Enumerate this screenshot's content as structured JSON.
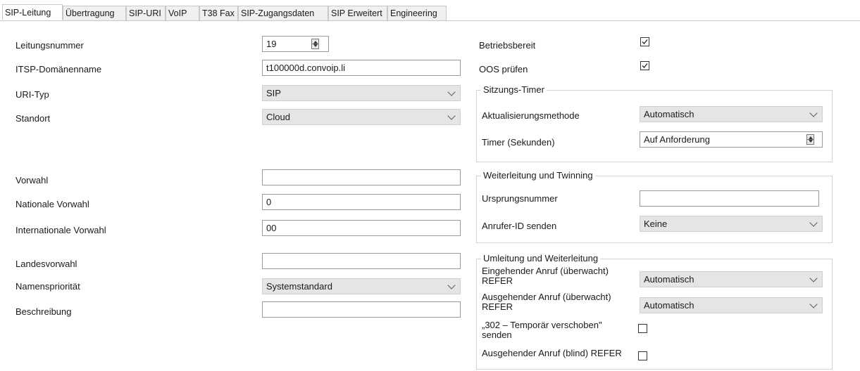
{
  "tabs": [
    "SIP-Leitung",
    "Übertragung",
    "SIP-URI",
    "VoIP",
    "T38 Fax",
    "SIP-Zugangsdaten",
    "SIP Erweitert",
    "Engineering"
  ],
  "left": {
    "leitungsnummer": {
      "label": "Leitungsnummer",
      "value": "19"
    },
    "itsp": {
      "label": "ITSP-Domänenname",
      "value": "t100000d.convoip.li"
    },
    "uri_typ": {
      "label": "URI-Typ",
      "value": "SIP"
    },
    "standort": {
      "label": "Standort",
      "value": "Cloud"
    },
    "vorwahl": {
      "label": "Vorwahl",
      "value": ""
    },
    "nationale_vorwahl": {
      "label": "Nationale Vorwahl",
      "value": "0"
    },
    "internationale_vorwahl": {
      "label": "Internationale Vorwahl",
      "value": "00"
    },
    "landesvorwahl": {
      "label": "Landesvorwahl",
      "value": ""
    },
    "namensprioritaet": {
      "label": "Namenspriorität",
      "value": "Systemstandard"
    },
    "beschreibung": {
      "label": "Beschreibung",
      "value": ""
    }
  },
  "right": {
    "betriebsbereit": {
      "label": "Betriebsbereit",
      "checked": true
    },
    "oos": {
      "label": "OOS prüfen",
      "checked": true
    },
    "sitzungs_timer": {
      "title": "Sitzungs-Timer",
      "methode_label": "Aktualisierungsmethode",
      "methode_value": "Automatisch",
      "timer_label": "Timer (Sekunden)",
      "timer_value": "Auf Anforderung"
    },
    "weiterleitung": {
      "title": "Weiterleitung und Twinning",
      "ursprung_label": "Ursprungsnummer",
      "ursprung_value": "",
      "anrufer_label": "Anrufer-ID senden",
      "anrufer_value": "Keine"
    },
    "umleitung": {
      "title": "Umleitung und Weiterleitung",
      "eingehend_label_1": "Eingehender Anruf (überwacht)",
      "eingehend_label_2": "REFER",
      "eingehend_value": "Automatisch",
      "ausgehend_label_1": "Ausgehender Anruf (überwacht)",
      "ausgehend_label_2": "REFER",
      "ausgehend_value": "Automatisch",
      "temp_label_1": "„302 – Temporär verschoben\"",
      "temp_label_2": "senden",
      "temp_checked": false,
      "blind_label": "Ausgehender Anruf (blind) REFER",
      "blind_checked": false
    }
  }
}
